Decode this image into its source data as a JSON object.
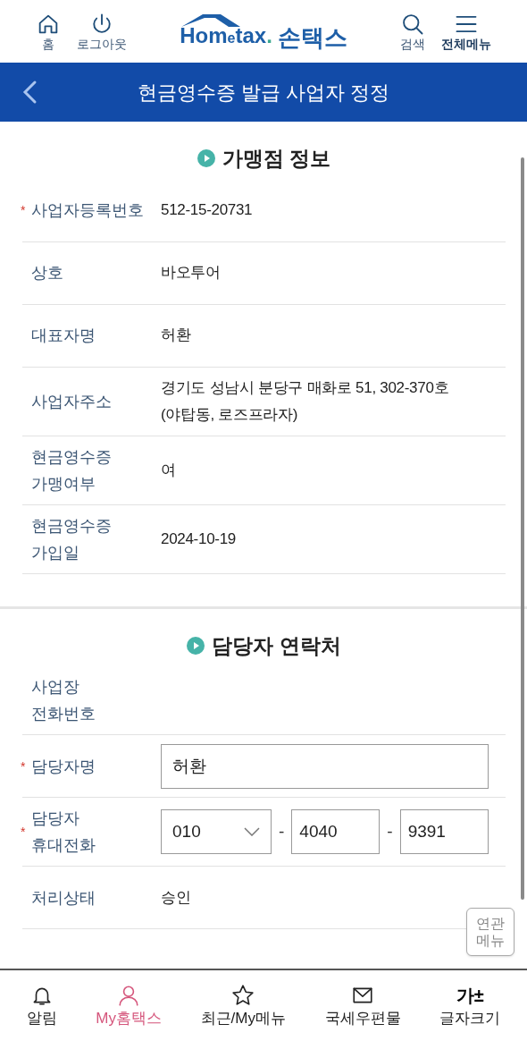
{
  "header": {
    "left_buttons": [
      {
        "kind": "home",
        "label": "홈"
      },
      {
        "kind": "power",
        "label": "로그아웃"
      }
    ],
    "logo": {
      "brand_parts": [
        "Hom",
        "e",
        "tax",
        "."
      ],
      "name": "손택스"
    },
    "right_buttons": [
      {
        "kind": "search",
        "label": "검색"
      },
      {
        "kind": "menu",
        "label": "전체메뉴"
      }
    ]
  },
  "title_bar": {
    "title": "현금영수증 발급 사업자 정정"
  },
  "sections": [
    {
      "title": "가맹점 정보",
      "rows": [
        {
          "kind": "text",
          "required_mark": "*",
          "label_lines": [
            "사업자등록번호"
          ],
          "value_lines": [
            "512-15-20731"
          ]
        },
        {
          "kind": "text",
          "label_lines": [
            "상호"
          ],
          "value_lines": [
            "바오투어"
          ]
        },
        {
          "kind": "text",
          "label_lines": [
            "대표자명"
          ],
          "value_lines": [
            "허환"
          ]
        },
        {
          "kind": "text",
          "label_lines": [
            "사업자주소"
          ],
          "value_lines": [
            "경기도 성남시 분당구 매화로 51, 302-370호",
            "(야탑동, 로즈프라자)"
          ]
        },
        {
          "kind": "text",
          "label_lines": [
            "현금영수증",
            "가맹여부"
          ],
          "value_lines": [
            "여"
          ]
        },
        {
          "kind": "text",
          "label_lines": [
            "현금영수증",
            "가입일"
          ],
          "value_lines": [
            "2024-10-19"
          ]
        }
      ]
    },
    {
      "title": "담당자 연락처",
      "rows": [
        {
          "kind": "text",
          "label_lines": [
            "사업장",
            "전화번호"
          ]
        },
        {
          "kind": "input",
          "required_mark": "*",
          "label_lines": [
            "담당자명"
          ],
          "value": "허환"
        },
        {
          "kind": "phone",
          "required_mark": "*",
          "label_lines": [
            "담당자",
            "휴대전화"
          ],
          "parts": [
            "010",
            "4040",
            "9391"
          ],
          "separator": "-"
        },
        {
          "kind": "text",
          "label_lines": [
            "처리상태"
          ],
          "value_lines": [
            "승인"
          ]
        }
      ]
    }
  ],
  "floating_button": {
    "label_lines": [
      "연관",
      "메뉴"
    ]
  },
  "bottom_nav": [
    {
      "kind": "bell",
      "label": "알림",
      "selected": false
    },
    {
      "kind": "user",
      "label": "My홈택스",
      "selected": true
    },
    {
      "kind": "star",
      "label": "최근/My메뉴",
      "selected": false
    },
    {
      "kind": "mail",
      "label": "국세우편물",
      "selected": false
    },
    {
      "kind": "text",
      "icon_text": "가±",
      "label": "글자크기",
      "selected": false
    }
  ]
}
